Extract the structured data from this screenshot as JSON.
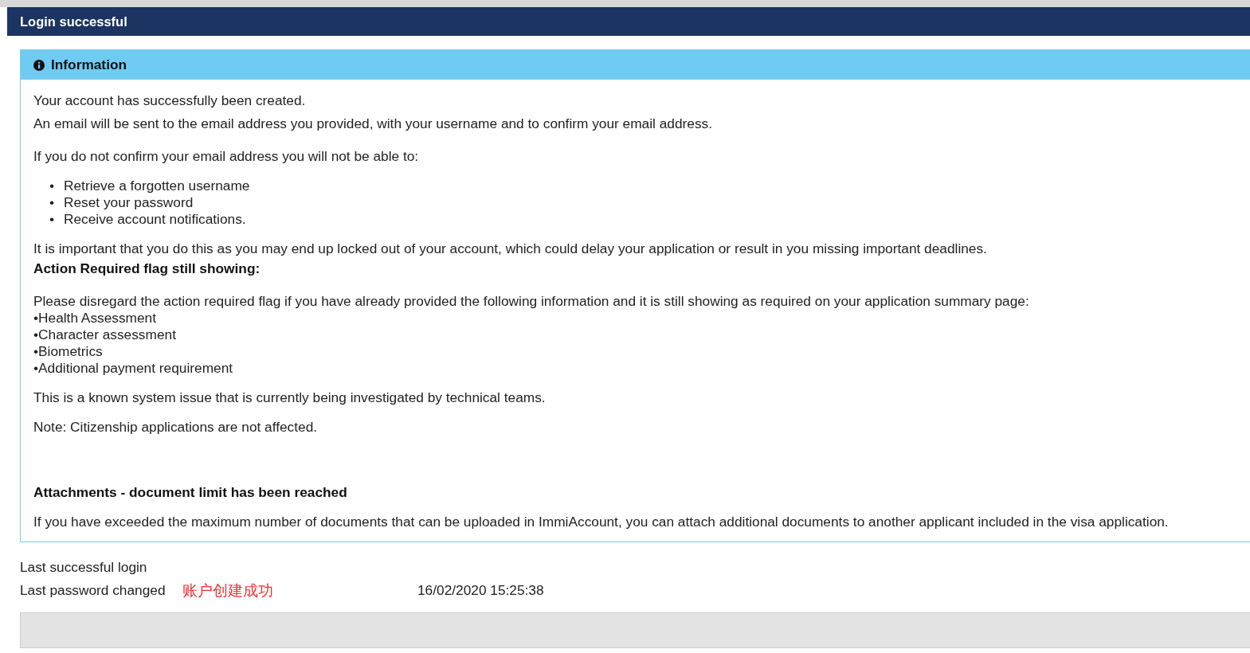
{
  "header": {
    "title": "Login successful"
  },
  "panel": {
    "title": "Information",
    "intro": [
      "Your account has successfully been created.",
      "An email will be sent to the email address you provided, with your username and to confirm your email address."
    ],
    "warning": "If you do not confirm your email address you will not be able to:",
    "bullet_marker": "•",
    "bullets": [
      "Retrieve a forgotten username",
      "Reset your password",
      "Receive account notifications."
    ],
    "important": "It is important that you do this as you may end up locked out of your account, which could delay your application or result in you missing important deadlines.",
    "flag_heading": "Action Required flag still showing:",
    "flag_text": "Please disregard the action required flag if you have already provided the following information and it is still showing as required on your application summary page:",
    "flag_items": [
      "•Health Assessment",
      "•Character assessment",
      "•Biometrics",
      "•Additional payment requirement"
    ],
    "known_issue": "This is a known system issue that is currently being investigated by technical teams.",
    "note": "Note: Citizenship applications are not affected.",
    "attach_heading": "Attachments - document limit has been reached",
    "attach_text": "If you have exceeded the maximum number of documents that can be uploaded in ImmiAccount, you can attach additional documents to another applicant included in the visa application."
  },
  "login_info": {
    "last_login_label": "Last successful login",
    "last_password_label": "Last password changed",
    "annotation": "账户创建成功",
    "date": "16/02/2020 15:25:38"
  }
}
